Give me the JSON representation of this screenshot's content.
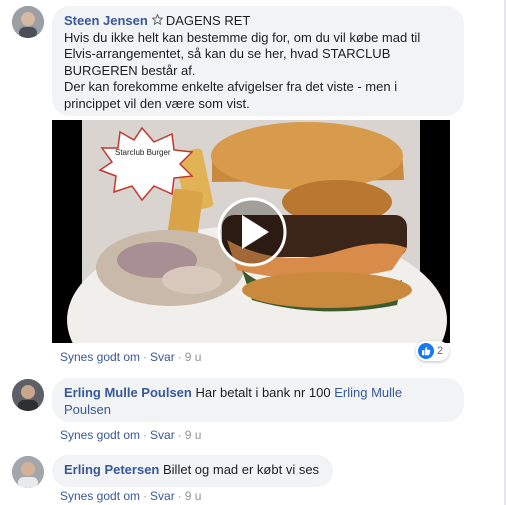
{
  "comments": [
    {
      "author": "Steen Jensen",
      "badge": "DAGENS RET",
      "lines": [
        "Hvis du ikke helt kan bestemme dig for, om du vil købe mad til",
        "Elvis-arrangementet, så kan du se her, hvad STARCLUB",
        "BURGEREN består af.",
        "Der kan forekomme enkelte afvigelser fra det viste - men i",
        "princippet vil den være som vist."
      ],
      "video": {
        "label": "Starclub Burger"
      },
      "reactions": {
        "icon": "like-icon",
        "count": "2"
      },
      "actions": {
        "like": "Synes godt om",
        "reply": "Svar",
        "time": "9 u"
      }
    },
    {
      "author": "Erling Mulle Poulsen",
      "text": "Har betalt i bank nr 100",
      "mention_line1": "Erling Mulle",
      "mention_line2": "Poulsen",
      "actions": {
        "like": "Synes godt om",
        "reply": "Svar",
        "time": "9 u"
      }
    },
    {
      "author": "Erling Petersen",
      "text": "Billet og mad er købt vi ses",
      "actions": {
        "like": "Synes godt om",
        "reply": "Svar",
        "time": "9 u"
      }
    }
  ],
  "colors": {
    "link": "#385898",
    "bubble": "#f2f3f5",
    "muted": "#90949c",
    "like": "#1877f2"
  }
}
